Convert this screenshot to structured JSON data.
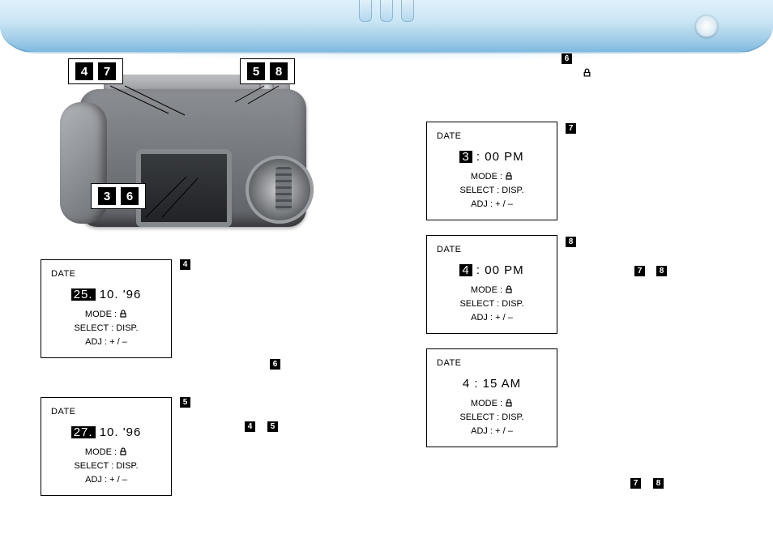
{
  "callouts": {
    "tl": [
      "4",
      "7"
    ],
    "tr": [
      "5",
      "8"
    ],
    "mid": [
      "3",
      "6"
    ]
  },
  "lcd_common": {
    "title": "DATE",
    "mode_label": "MODE :",
    "select_label": "SELECT : DISP.",
    "adj_label": "ADJ : + / –"
  },
  "lcd": {
    "d1": {
      "line": "",
      "day_inv": "25.",
      "rest": " 10.  '96"
    },
    "d2": {
      "line": "",
      "day_inv": "27.",
      "rest": " 10.  '96"
    },
    "t1": {
      "hour_inv": "3",
      "rest": " : 00  PM"
    },
    "t2": {
      "hour_inv": "4",
      "rest": " : 00  PM"
    },
    "t3": {
      "plain": "4 : 15  AM"
    }
  },
  "markers": {
    "a": "4",
    "b": "5",
    "c": "6",
    "d": "6",
    "e": "7",
    "f": "8",
    "g": "7",
    "h": "8",
    "i": "4",
    "j": "5",
    "k": "7",
    "l": "8"
  }
}
